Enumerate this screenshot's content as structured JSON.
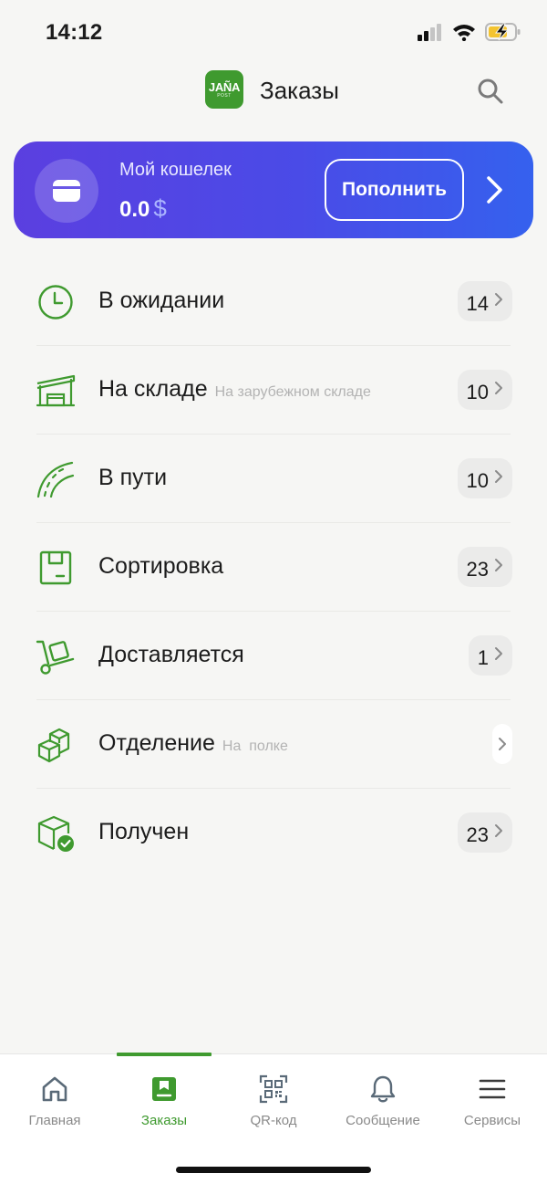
{
  "status_bar": {
    "time": "14:12"
  },
  "header": {
    "logo_main": "JAÑA",
    "logo_sub": "POST",
    "title": "Заказы"
  },
  "wallet": {
    "label": "Мой кошелек",
    "balance": "0.0",
    "currency": "$",
    "topup_label": "Пополнить"
  },
  "orders": [
    {
      "label": "В ожидании",
      "sub": "",
      "count": "14",
      "icon": "clock-icon"
    },
    {
      "label": "На складе",
      "sub": "На зарубежном складе",
      "count": "10",
      "icon": "warehouse-icon"
    },
    {
      "label": "В пути",
      "sub": "",
      "count": "10",
      "icon": "road-icon"
    },
    {
      "label": "Сортировка",
      "sub": "",
      "count": "23",
      "icon": "box-icon"
    },
    {
      "label": "Доставляется",
      "sub": "",
      "count": "1",
      "icon": "hand-truck-icon"
    },
    {
      "label": "Отделение",
      "sub": "На  полке",
      "count": "",
      "icon": "boxes-icon"
    },
    {
      "label": "Получен",
      "sub": "",
      "count": "23",
      "icon": "box-check-icon"
    }
  ],
  "nav": {
    "items": [
      {
        "label": "Главная",
        "icon": "home-icon"
      },
      {
        "label": "Заказы",
        "icon": "orders-icon"
      },
      {
        "label": "QR-код",
        "icon": "qr-code-icon"
      },
      {
        "label": "Сообщение",
        "icon": "bell-icon"
      },
      {
        "label": "Сервисы",
        "icon": "menu-icon"
      }
    ],
    "active_index": 1
  },
  "colors": {
    "accent_green": "#3f9a2f",
    "wallet_gradient_start": "#5b3fe0",
    "wallet_gradient_end": "#3561ee",
    "battery_yellow": "#f4c430"
  }
}
